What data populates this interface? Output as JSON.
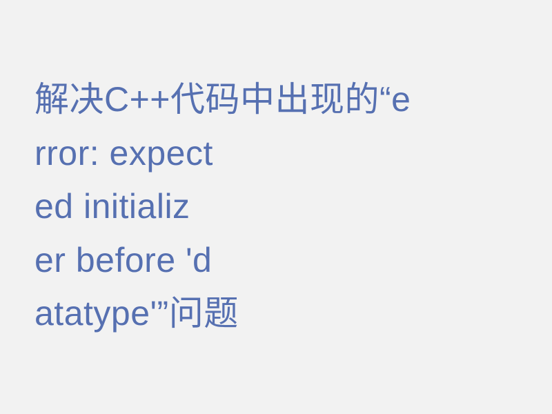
{
  "text": {
    "line1": "解决C++代码中出现的“e",
    "line2": "rror: expect",
    "line3": "ed initializ",
    "line4": "er before 'd",
    "line5": "atatype'”问题"
  }
}
